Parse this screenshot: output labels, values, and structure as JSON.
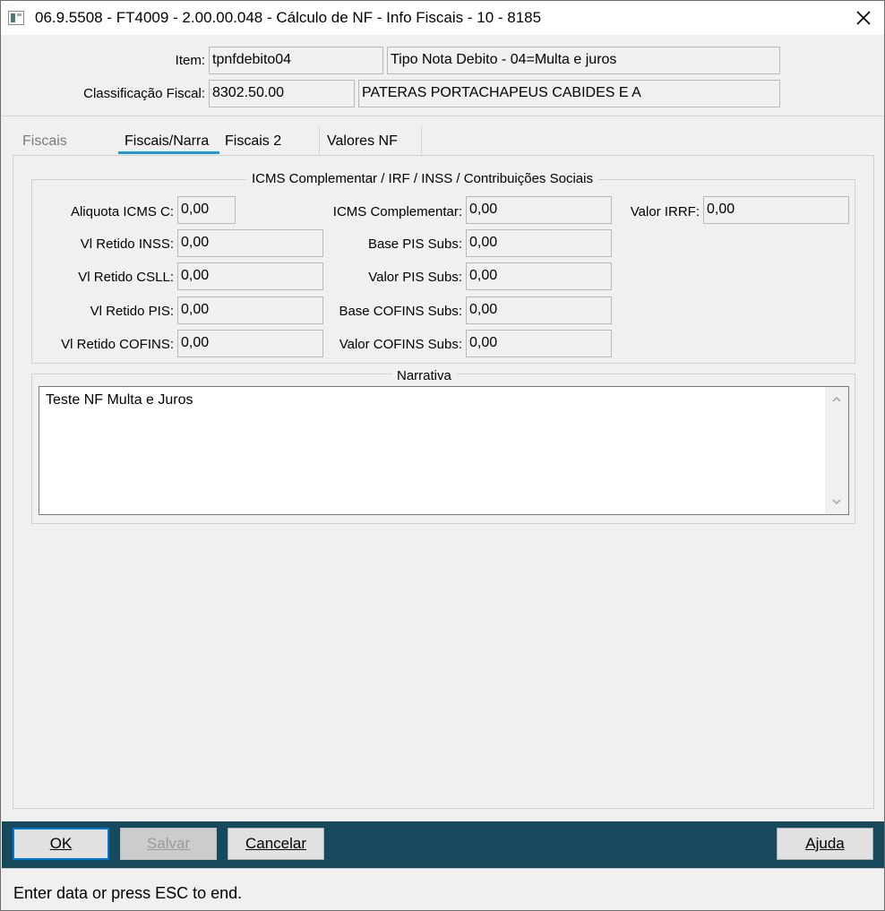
{
  "window": {
    "title": "06.9.5508 - FT4009 - 2.00.00.048 - Cálculo de NF - Info Fiscais - 10 - 8185"
  },
  "header": {
    "item_label": "Item:",
    "item_code": "tpnfdebito04",
    "item_desc": "Tipo Nota Debito - 04=Multa e juros",
    "class_label": "Classificação Fiscal:",
    "class_code": "8302.50.00",
    "class_desc": "PATERAS PORTACHAPEUS CABIDES E A"
  },
  "tabs": [
    {
      "label": "Fiscais",
      "active": false
    },
    {
      "label": "Fiscais/Narra",
      "active": true
    },
    {
      "label": "Fiscais 2",
      "active": false
    },
    {
      "label": "Valores NF",
      "active": false
    }
  ],
  "icms_group": {
    "title": "ICMS Complementar / IRF / INSS / Contribuições Sociais",
    "aliquota_icms_c": {
      "label": "Aliquota ICMS C:",
      "value": "0,00"
    },
    "vl_retido_inss": {
      "label": "Vl Retido INSS:",
      "value": "0,00"
    },
    "vl_retido_csll": {
      "label": "Vl Retido CSLL:",
      "value": "0,00"
    },
    "vl_retido_pis": {
      "label": "Vl Retido PIS:",
      "value": "0,00"
    },
    "vl_retido_cofins": {
      "label": "Vl Retido COFINS:",
      "value": "0,00"
    },
    "icms_complementar": {
      "label": "ICMS Complementar:",
      "value": "0,00"
    },
    "base_pis_subs": {
      "label": "Base PIS Subs:",
      "value": "0,00"
    },
    "valor_pis_subs": {
      "label": "Valor PIS Subs:",
      "value": "0,00"
    },
    "base_cofins_subs": {
      "label": "Base COFINS Subs:",
      "value": "0,00"
    },
    "valor_cofins_subs": {
      "label": "Valor COFINS Subs:",
      "value": "0,00"
    },
    "valor_irrf": {
      "label": "Valor IRRF:",
      "value": "0,00"
    }
  },
  "narrativa": {
    "title": "Narrativa",
    "text": "Teste NF Multa e Juros"
  },
  "buttons": {
    "ok": "OK",
    "salvar": "Salvar",
    "cancelar": "Cancelar",
    "ajuda": "Ajuda"
  },
  "status_bar": {
    "text": "Enter data or press ESC to end."
  },
  "colors": {
    "accent": "#1a9bd7",
    "footer": "#15495b",
    "default_button_border": "#0078d7"
  },
  "icons": {
    "app": "app-window-icon",
    "close": "close-icon",
    "scroll_up": "chevron-up-icon",
    "scroll_down": "chevron-down-icon"
  }
}
